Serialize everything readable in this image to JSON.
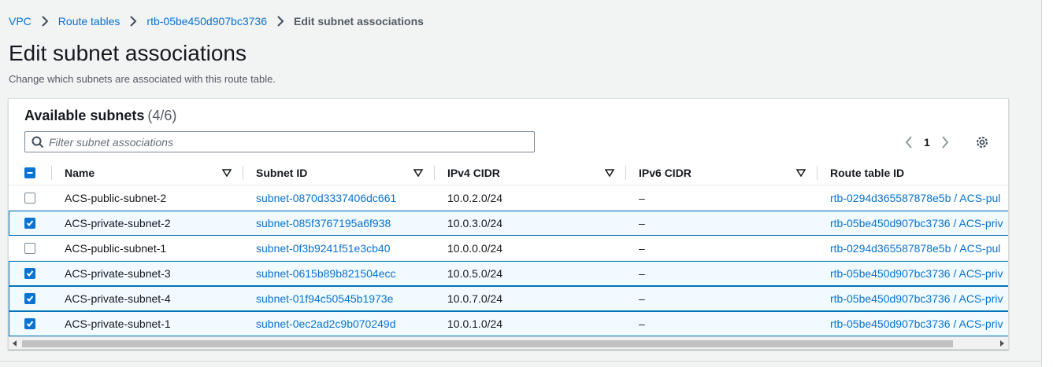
{
  "breadcrumb": {
    "items": [
      "VPC",
      "Route tables",
      "rtb-05be450d907bc3736"
    ],
    "current": "Edit subnet associations"
  },
  "page": {
    "title": "Edit subnet associations",
    "description": "Change which subnets are associated with this route table."
  },
  "panel": {
    "title": "Available subnets",
    "count": "(4/6)",
    "filter_placeholder": "Filter subnet associations",
    "page_number": "1"
  },
  "table": {
    "columns": [
      "Name",
      "Subnet ID",
      "IPv4 CIDR",
      "IPv6 CIDR",
      "Route table ID"
    ],
    "rows": [
      {
        "selected": false,
        "name": "ACS-public-subnet-2",
        "subnet_id": "subnet-0870d3337406dc661",
        "ipv4": "10.0.2.0/24",
        "ipv6": "–",
        "route_table": "rtb-0294d365587878e5b / ACS-pul"
      },
      {
        "selected": true,
        "name": "ACS-private-subnet-2",
        "subnet_id": "subnet-085f3767195a6f938",
        "ipv4": "10.0.3.0/24",
        "ipv6": "–",
        "route_table": "rtb-05be450d907bc3736 / ACS-priv"
      },
      {
        "selected": false,
        "name": "ACS-public-subnet-1",
        "subnet_id": "subnet-0f3b9241f51e3cb40",
        "ipv4": "10.0.0.0/24",
        "ipv6": "–",
        "route_table": "rtb-0294d365587878e5b / ACS-pul"
      },
      {
        "selected": true,
        "name": "ACS-private-subnet-3",
        "subnet_id": "subnet-0615b89b821504ecc",
        "ipv4": "10.0.5.0/24",
        "ipv6": "–",
        "route_table": "rtb-05be450d907bc3736 / ACS-priv"
      },
      {
        "selected": true,
        "name": "ACS-private-subnet-4",
        "subnet_id": "subnet-01f94c50545b1973e",
        "ipv4": "10.0.7.0/24",
        "ipv6": "–",
        "route_table": "rtb-05be450d907bc3736 / ACS-priv"
      },
      {
        "selected": true,
        "name": "ACS-private-subnet-1",
        "subnet_id": "subnet-0ec2ad2c9b070249d",
        "ipv4": "10.0.1.0/24",
        "ipv6": "–",
        "route_table": "rtb-05be450d907bc3736 / ACS-priv"
      }
    ]
  },
  "colors": {
    "link": "#0972d3",
    "selected_row_bg": "#f1faff",
    "selected_row_border": "#0073bb"
  }
}
